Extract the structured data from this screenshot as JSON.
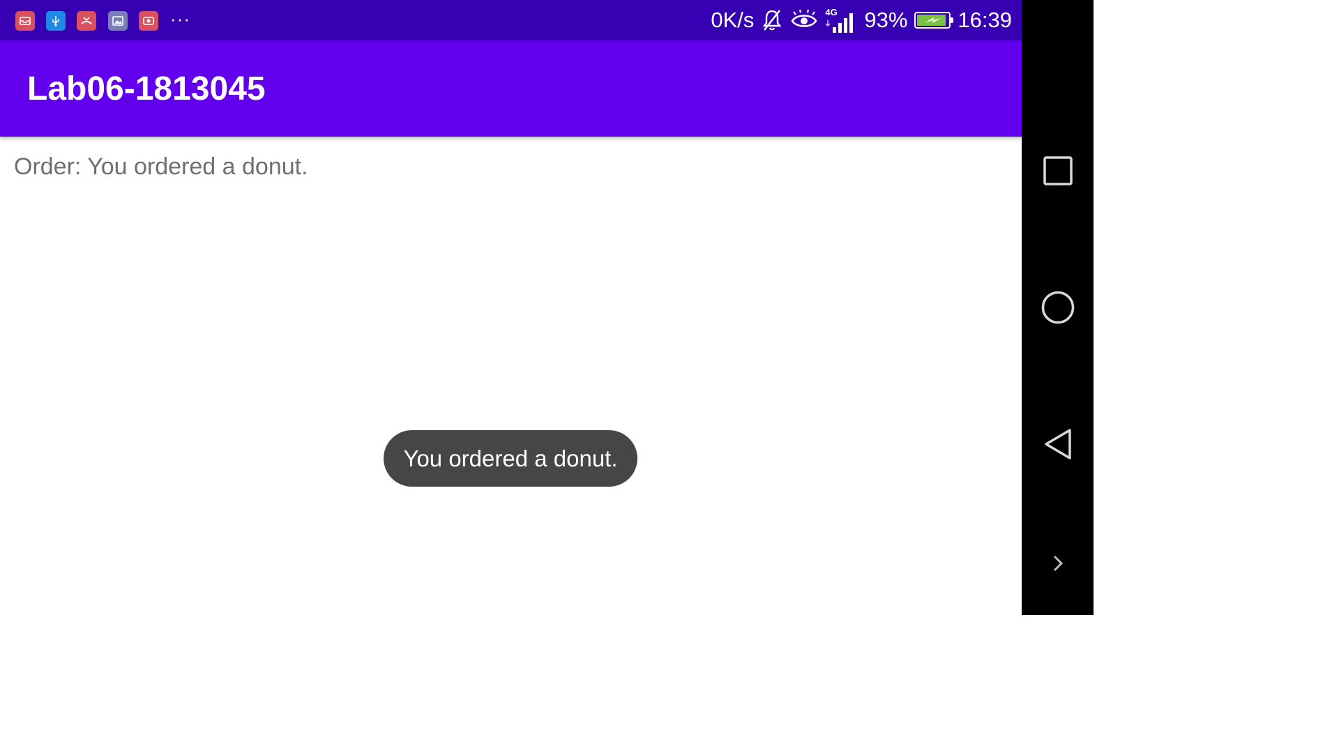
{
  "status_bar": {
    "net_speed": "0K/s",
    "network_type": "4G",
    "battery_percent": "93%",
    "battery_level": 0.93,
    "time": "16:39",
    "notification_icons": [
      "mail-icon",
      "usb-icon",
      "missed-call-icon",
      "gallery-icon",
      "screen-recorder-icon"
    ],
    "more_label": "···"
  },
  "app_bar": {
    "title": "Lab06-1813045"
  },
  "main": {
    "order_text": "Order: You ordered a donut."
  },
  "toast": {
    "message": "You ordered a donut."
  },
  "nav_bar": {
    "buttons": [
      "recents-icon",
      "home-icon",
      "back-icon",
      "expand-icon"
    ]
  },
  "colors": {
    "status_bar": "#3700b3",
    "app_bar": "#6200ee",
    "toast_bg": "#464646",
    "order_text": "#6f6f6f",
    "battery_fill": "#7cc242"
  }
}
